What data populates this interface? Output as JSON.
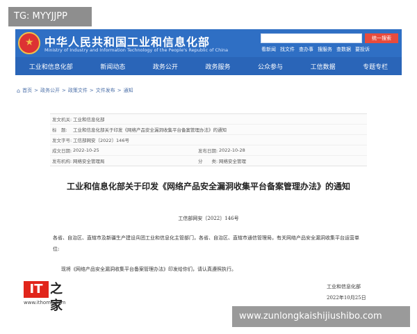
{
  "overlays": {
    "tg": "TG: MYYJJPP",
    "bottom_watermark": "www.zunlongkaishijiushibo.com"
  },
  "site": {
    "title": "中华人民共和国工业和信息化部",
    "subtitle": "Ministry of Industry and Information Technology of the People's Republic of China",
    "search_button": "统一搜索",
    "toplinks": [
      "看新闻",
      "找文件",
      "查办事",
      "搜服务",
      "查数据",
      "要投诉"
    ]
  },
  "nav": [
    "工业和信息化部",
    "新闻动态",
    "政务公开",
    "政务服务",
    "公众参与",
    "工信数据",
    "专题专栏"
  ],
  "breadcrumb": [
    "首页",
    "政务公开",
    "政策文件",
    "文件发布",
    "通知"
  ],
  "meta": {
    "rows": [
      {
        "k": "发文机关:",
        "v": "工业和信息化部"
      },
      {
        "k": "标　题:",
        "v": "工业和信息化部关于印发《网络产品安全漏洞收集平台备案管理办法》的通知"
      },
      {
        "k": "发文字号:",
        "v": "工信部网安〔2022〕146号"
      }
    ],
    "dates": {
      "k1": "成文日期:",
      "v1": "2022-10-25",
      "k2": "发布日期:",
      "v2": "2022-10-28"
    },
    "org": {
      "k1": "发布机构:",
      "v1": "网络安全管理局",
      "k2": "分　　类:",
      "v2": "网络安全管理"
    }
  },
  "doc": {
    "title": "工业和信息化部关于印发《网络产品安全漏洞收集平台备案管理办法》的通知",
    "number": "工信部网安〔2022〕146号",
    "p1": "各省、自治区、直辖市及新疆生产建设兵团工业和信息化主管部门，各省、自治区、直辖市通信管理局，有关网络产品安全漏洞收集平台运营单位:",
    "p2": "现将《网络产品安全漏洞收集平台备案管理办法》印发给你们，请认真遵照执行。",
    "sign_org": "工业和信息化部",
    "sign_date": "2022年10月25日"
  },
  "ithome": {
    "badge": "IT",
    "mark": "之家",
    "url": "www.ithome.com"
  }
}
